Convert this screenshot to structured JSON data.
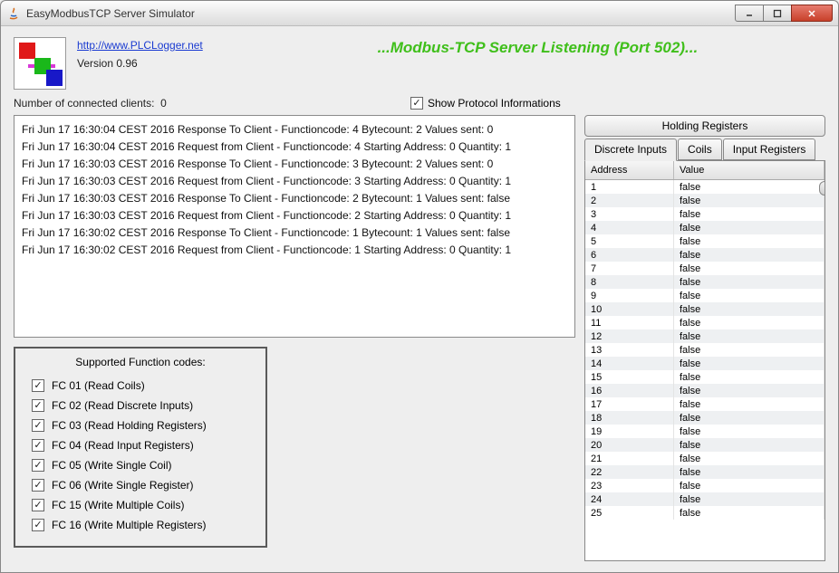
{
  "window": {
    "title": "EasyModbusTCP Server Simulator"
  },
  "header": {
    "link_text": "http://www.PLCLogger.net",
    "version": "Version 0.96",
    "listening": "...Modbus-TCP Server Listening (Port 502)..."
  },
  "clients": {
    "label": "Number of connected clients:",
    "count": "0"
  },
  "show_protocol_label": "Show Protocol Informations",
  "log": [
    "Fri Jun 17 16:30:04 CEST 2016 Response To Client - Functioncode: 4 Bytecount: 2 Values sent: 0",
    "Fri Jun 17 16:30:04 CEST 2016 Request from Client - Functioncode: 4 Starting Address: 0 Quantity: 1",
    "Fri Jun 17 16:30:03 CEST 2016 Response To Client - Functioncode: 3 Bytecount: 2 Values sent: 0",
    "Fri Jun 17 16:30:03 CEST 2016 Request from Client - Functioncode: 3 Starting Address: 0 Quantity: 1",
    "Fri Jun 17 16:30:03 CEST 2016 Response To Client - Functioncode: 2 Bytecount: 1 Values sent: false",
    "Fri Jun 17 16:30:03 CEST 2016 Request from Client - Functioncode: 2 Starting Address: 0 Quantity: 1",
    "Fri Jun 17 16:30:02 CEST 2016 Response To Client - Functioncode: 1 Bytecount: 1 Values sent: false",
    "Fri Jun 17 16:30:02 CEST 2016 Request from Client - Functioncode: 1 Starting Address: 0 Quantity: 1"
  ],
  "fcodes": {
    "title": "Supported Function codes:",
    "items": [
      "FC 01 (Read Coils)",
      "FC 02 (Read Discrete Inputs)",
      "FC 03 (Read Holding Registers)",
      "FC 04 (Read Input Registers)",
      "FC 05 (Write Single Coil)",
      "FC 06 (Write Single Register)",
      "FC 15 (Write Multiple Coils)",
      "FC 16 (Write Multiple Registers)"
    ]
  },
  "right": {
    "holding_btn": "Holding Registers",
    "tabs": {
      "discrete": "Discrete Inputs",
      "coils": "Coils",
      "inputreg": "Input Registers"
    },
    "columns": {
      "address": "Address",
      "value": "Value"
    },
    "rows": [
      {
        "a": "1",
        "v": "false"
      },
      {
        "a": "2",
        "v": "false"
      },
      {
        "a": "3",
        "v": "false"
      },
      {
        "a": "4",
        "v": "false"
      },
      {
        "a": "5",
        "v": "false"
      },
      {
        "a": "6",
        "v": "false"
      },
      {
        "a": "7",
        "v": "false"
      },
      {
        "a": "8",
        "v": "false"
      },
      {
        "a": "9",
        "v": "false"
      },
      {
        "a": "10",
        "v": "false"
      },
      {
        "a": "11",
        "v": "false"
      },
      {
        "a": "12",
        "v": "false"
      },
      {
        "a": "13",
        "v": "false"
      },
      {
        "a": "14",
        "v": "false"
      },
      {
        "a": "15",
        "v": "false"
      },
      {
        "a": "16",
        "v": "false"
      },
      {
        "a": "17",
        "v": "false"
      },
      {
        "a": "18",
        "v": "false"
      },
      {
        "a": "19",
        "v": "false"
      },
      {
        "a": "20",
        "v": "false"
      },
      {
        "a": "21",
        "v": "false"
      },
      {
        "a": "22",
        "v": "false"
      },
      {
        "a": "23",
        "v": "false"
      },
      {
        "a": "24",
        "v": "false"
      },
      {
        "a": "25",
        "v": "false"
      }
    ]
  }
}
